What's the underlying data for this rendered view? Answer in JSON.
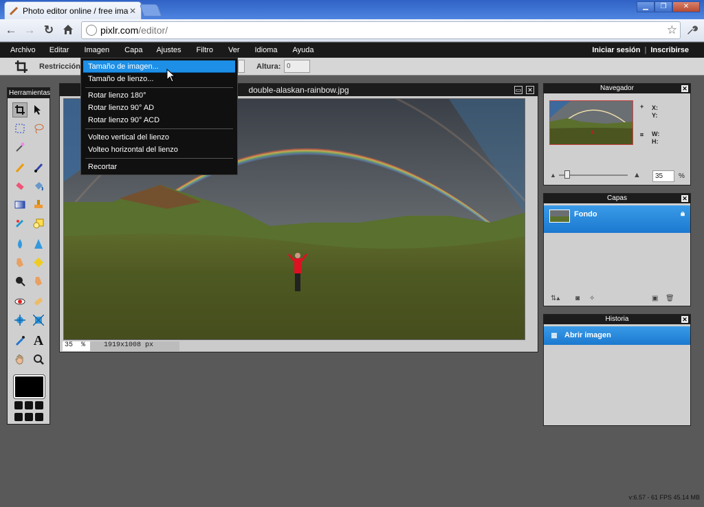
{
  "browser": {
    "tab_title": "Photo editor online / free imag",
    "url_domain": "pixlr.com",
    "url_path": "/editor/"
  },
  "menubar": {
    "items": [
      "Archivo",
      "Editar",
      "Imagen",
      "Capa",
      "Ajustes",
      "Filtro",
      "Ver",
      "Idioma",
      "Ayuda"
    ],
    "login": "Iniciar sesión",
    "signup": "Inscribirse"
  },
  "optionsbar": {
    "restriction_label": "Restricción",
    "height_label": "Altura:",
    "height_value": "0"
  },
  "tools_panel": {
    "title": "Herramientas"
  },
  "dropdown": {
    "items": [
      "Tamaño de imagen...",
      "Tamaño de lienzo...",
      "Rotar lienzo 180°",
      "Rotar lienzo 90° AD",
      "Rotar lienzo 90° ACD",
      "Volteo vertical del lienzo",
      "Volteo horizontal del lienzo",
      "Recortar"
    ]
  },
  "document": {
    "filename": "double-alaskan-rainbow.jpg",
    "zoom": "35",
    "zoom_unit": "%",
    "dimensions": "1919x1008 px"
  },
  "navigator": {
    "title": "Navegador",
    "x_label": "X:",
    "y_label": "Y:",
    "w_label": "W:",
    "h_label": "H:",
    "zoom_value": "35",
    "zoom_unit": "%"
  },
  "layers": {
    "title": "Capas",
    "layer_name": "Fondo"
  },
  "history": {
    "title": "Historia",
    "entry": "Abrir imagen"
  },
  "footer": {
    "status": "v:6.57 - 61 FPS 45.14 MB"
  },
  "colors": {
    "accent": "#1d8fe6",
    "panel_bg": "#cfcfcf",
    "menubar_bg": "#1a1a1a"
  }
}
